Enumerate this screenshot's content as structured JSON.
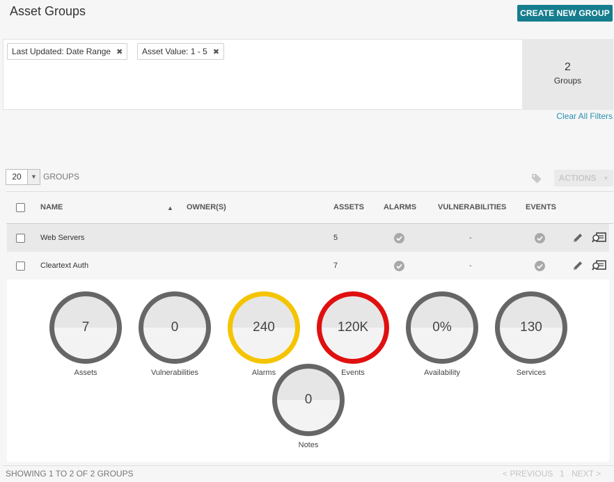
{
  "header": {
    "title": "Asset Groups",
    "create_label": "CREATE NEW GROUP"
  },
  "filters": {
    "chips": [
      "Last Updated: Date Range",
      "Asset Value: 1 - 5"
    ],
    "remove_glyph": "✖",
    "count": "2",
    "count_label": "Groups",
    "clear_label": "Clear All Filters"
  },
  "toolbar": {
    "per_page": "20",
    "groups_label": "GROUPS",
    "actions_label": "ACTIONS",
    "tag_icon": "tag-icon"
  },
  "table": {
    "columns": {
      "name": "NAME",
      "owners": "OWNER(S)",
      "assets": "ASSETS",
      "alarms": "ALARMS",
      "vulnerabilities": "VULNERABILITIES",
      "events": "EVENTS"
    },
    "sort_glyph": "▲",
    "rows": [
      {
        "name": "Web Servers",
        "owners": "",
        "assets": "5",
        "vulnerabilities": "-"
      },
      {
        "name": "Cleartext Auth",
        "owners": "",
        "assets": "7",
        "vulnerabilities": "-"
      }
    ]
  },
  "details": {
    "stats": [
      {
        "value": "7",
        "label": "Assets",
        "color": "#666666"
      },
      {
        "value": "0",
        "label": "Vulnerabilities",
        "color": "#666666"
      },
      {
        "value": "240",
        "label": "Alarms",
        "color": "#f5c400"
      },
      {
        "value": "120K",
        "label": "Events",
        "color": "#e01010"
      },
      {
        "value": "0%",
        "label": "Availability",
        "color": "#666666"
      },
      {
        "value": "130",
        "label": "Services",
        "color": "#666666"
      },
      {
        "value": "0",
        "label": "Notes",
        "color": "#666666"
      }
    ]
  },
  "footer": {
    "showing": "SHOWING 1 TO 2 OF 2 GROUPS",
    "previous": "< PREVIOUS",
    "page": "1",
    "next": "NEXT >"
  }
}
